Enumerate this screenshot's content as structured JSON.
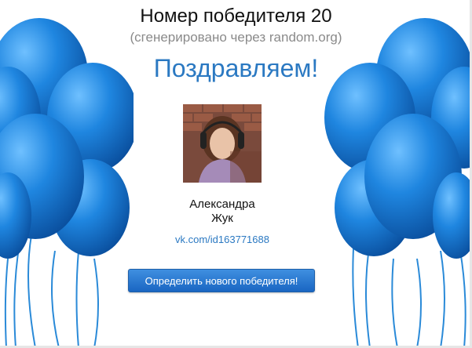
{
  "header": {
    "title": "Номер победителя 20",
    "subtitle": "(сгенерировано через random.org)"
  },
  "result": {
    "congrats": "Поздравляем!",
    "winner_first_name": "Александра",
    "winner_last_name": "Жук",
    "winner_link": "vk.com/id163771688"
  },
  "actions": {
    "new_winner_label": "Определить нового победителя!"
  },
  "colors": {
    "accent": "#2b79c2",
    "balloon": "#1a7ad4",
    "button": "#1a66c2"
  }
}
